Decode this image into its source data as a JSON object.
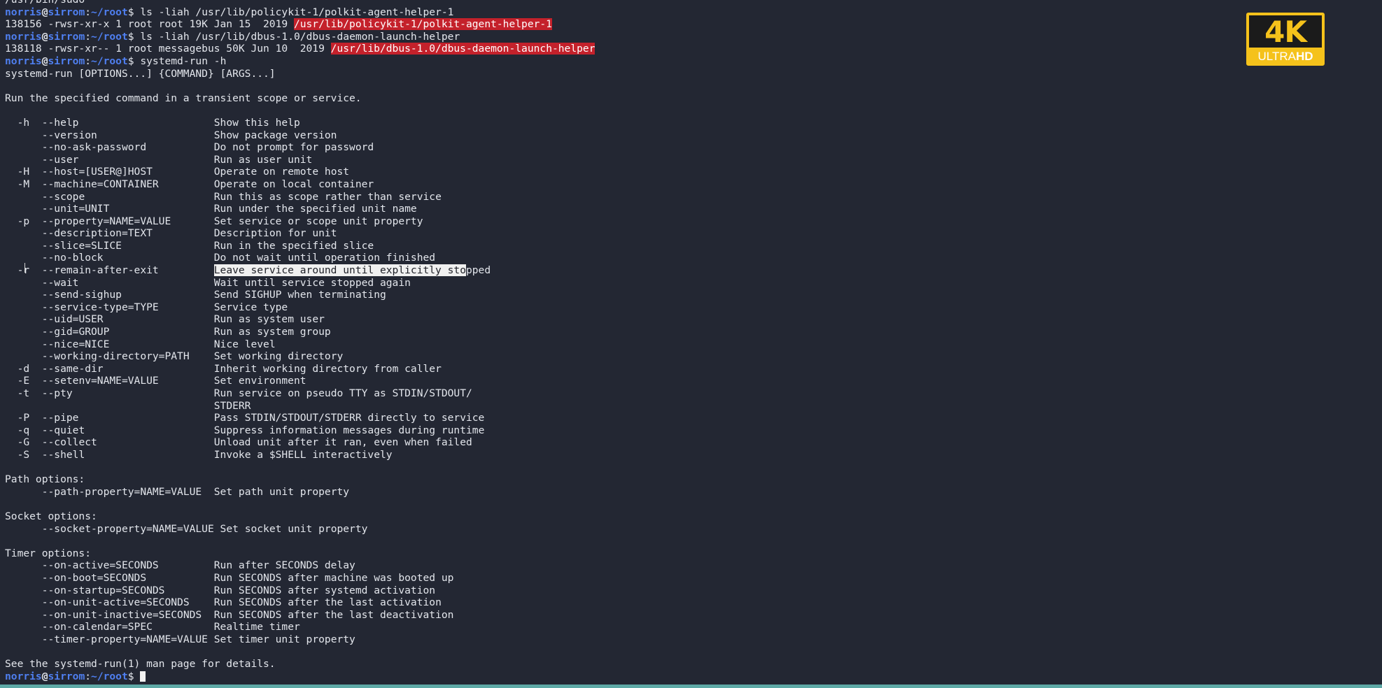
{
  "prompt": {
    "user": "norris",
    "at": "@",
    "host": "sirrom",
    "sep": ":",
    "path": "~/root",
    "dollar": "$"
  },
  "lines": [
    {
      "type": "plain",
      "text": "/usr/bin/sudo"
    },
    {
      "type": "cmd",
      "text": "ls -liah /usr/lib/policykit-1/polkit-agent-helper-1"
    },
    {
      "type": "hl",
      "pre": "138156 -rwsr-xr-x 1 root root 19K Jan 15  2019 ",
      "hl": "/usr/lib/policykit-1/polkit-agent-helper-1"
    },
    {
      "type": "cmd",
      "text": "ls -liah /usr/lib/dbus-1.0/dbus-daemon-launch-helper"
    },
    {
      "type": "hl",
      "pre": "138118 -rwsr-xr-- 1 root messagebus 50K Jun 10  2019 ",
      "hl": "/usr/lib/dbus-1.0/dbus-daemon-launch-helper"
    },
    {
      "type": "cmd",
      "text": "systemd-run -h"
    },
    {
      "type": "plain",
      "text": "systemd-run [OPTIONS...] {COMMAND} [ARGS...]"
    },
    {
      "type": "plain",
      "text": ""
    },
    {
      "type": "plain",
      "text": "Run the specified command in a transient scope or service."
    },
    {
      "type": "plain",
      "text": ""
    },
    {
      "type": "opt",
      "short": "-h",
      "long": "--help",
      "desc": "Show this help"
    },
    {
      "type": "opt",
      "short": "",
      "long": "--version",
      "desc": "Show package version"
    },
    {
      "type": "opt",
      "short": "",
      "long": "--no-ask-password",
      "desc": "Do not prompt for password"
    },
    {
      "type": "opt",
      "short": "",
      "long": "--user",
      "desc": "Run as user unit"
    },
    {
      "type": "opt",
      "short": "-H",
      "long": "--host=[USER@]HOST",
      "desc": "Operate on remote host"
    },
    {
      "type": "opt",
      "short": "-M",
      "long": "--machine=CONTAINER",
      "desc": "Operate on local container"
    },
    {
      "type": "opt",
      "short": "",
      "long": "--scope",
      "desc": "Run this as scope rather than service"
    },
    {
      "type": "opt",
      "short": "",
      "long": "--unit=UNIT",
      "desc": "Run under the specified unit name"
    },
    {
      "type": "opt",
      "short": "-p",
      "long": "--property=NAME=VALUE",
      "desc": "Set service or scope unit property"
    },
    {
      "type": "opt",
      "short": "",
      "long": "--description=TEXT",
      "desc": "Description for unit"
    },
    {
      "type": "opt",
      "short": "",
      "long": "--slice=SLICE",
      "desc": "Run in the specified slice"
    },
    {
      "type": "opt",
      "short": "",
      "long": "--no-block",
      "desc": "Do not wait until operation finished"
    },
    {
      "type": "opt",
      "short": "-r",
      "long": "--remain-after-exit",
      "desc": "Leave service around until explicitly stopped",
      "sel": "Leave service around until explicitly sto",
      "rest": "pped"
    },
    {
      "type": "opt",
      "short": "",
      "long": "--wait",
      "desc": "Wait until service stopped again"
    },
    {
      "type": "opt",
      "short": "",
      "long": "--send-sighup",
      "desc": "Send SIGHUP when terminating"
    },
    {
      "type": "opt",
      "short": "",
      "long": "--service-type=TYPE",
      "desc": "Service type"
    },
    {
      "type": "opt",
      "short": "",
      "long": "--uid=USER",
      "desc": "Run as system user"
    },
    {
      "type": "opt",
      "short": "",
      "long": "--gid=GROUP",
      "desc": "Run as system group"
    },
    {
      "type": "opt",
      "short": "",
      "long": "--nice=NICE",
      "desc": "Nice level"
    },
    {
      "type": "opt",
      "short": "",
      "long": "--working-directory=PATH",
      "desc": "Set working directory"
    },
    {
      "type": "opt",
      "short": "-d",
      "long": "--same-dir",
      "desc": "Inherit working directory from caller"
    },
    {
      "type": "opt",
      "short": "-E",
      "long": "--setenv=NAME=VALUE",
      "desc": "Set environment"
    },
    {
      "type": "opt",
      "short": "-t",
      "long": "--pty",
      "desc": "Run service on pseudo TTY as STDIN/STDOUT/"
    },
    {
      "type": "opt",
      "short": "",
      "long": "",
      "desc": "STDERR"
    },
    {
      "type": "opt",
      "short": "-P",
      "long": "--pipe",
      "desc": "Pass STDIN/STDOUT/STDERR directly to service"
    },
    {
      "type": "opt",
      "short": "-q",
      "long": "--quiet",
      "desc": "Suppress information messages during runtime"
    },
    {
      "type": "opt",
      "short": "-G",
      "long": "--collect",
      "desc": "Unload unit after it ran, even when failed"
    },
    {
      "type": "opt",
      "short": "-S",
      "long": "--shell",
      "desc": "Invoke a $SHELL interactively"
    },
    {
      "type": "plain",
      "text": ""
    },
    {
      "type": "plain",
      "text": "Path options:"
    },
    {
      "type": "opt",
      "short": "",
      "long": "--path-property=NAME=VALUE",
      "desc": "Set path unit property"
    },
    {
      "type": "plain",
      "text": ""
    },
    {
      "type": "plain",
      "text": "Socket options:"
    },
    {
      "type": "opt",
      "short": "",
      "long": "--socket-property=NAME=VALUE",
      "desc": "Set socket unit property"
    },
    {
      "type": "plain",
      "text": ""
    },
    {
      "type": "plain",
      "text": "Timer options:"
    },
    {
      "type": "opt",
      "short": "",
      "long": "--on-active=SECONDS",
      "desc": "Run after SECONDS delay"
    },
    {
      "type": "opt",
      "short": "",
      "long": "--on-boot=SECONDS",
      "desc": "Run SECONDS after machine was booted up"
    },
    {
      "type": "opt",
      "short": "",
      "long": "--on-startup=SECONDS",
      "desc": "Run SECONDS after systemd activation"
    },
    {
      "type": "opt",
      "short": "",
      "long": "--on-unit-active=SECONDS",
      "desc": "Run SECONDS after the last activation"
    },
    {
      "type": "opt",
      "short": "",
      "long": "--on-unit-inactive=SECONDS",
      "desc": "Run SECONDS after the last deactivation"
    },
    {
      "type": "opt",
      "short": "",
      "long": "--on-calendar=SPEC",
      "desc": "Realtime timer"
    },
    {
      "type": "opt",
      "short": "",
      "long": "--timer-property=NAME=VALUE",
      "desc": "Set timer unit property"
    },
    {
      "type": "plain",
      "text": ""
    },
    {
      "type": "plain",
      "text": "See the systemd-run(1) man page for details."
    },
    {
      "type": "prompt",
      "text": ""
    }
  ],
  "badge": {
    "top": "4K",
    "bottom_a": "ULTRA",
    "bottom_b": "HD"
  },
  "colors": {
    "background": "#232733",
    "prompt_blue": "#4f7ff0",
    "highlight_red": "#c4212b",
    "badge_gold": "#f5c21b",
    "status_bar": "#5ea9a6"
  }
}
